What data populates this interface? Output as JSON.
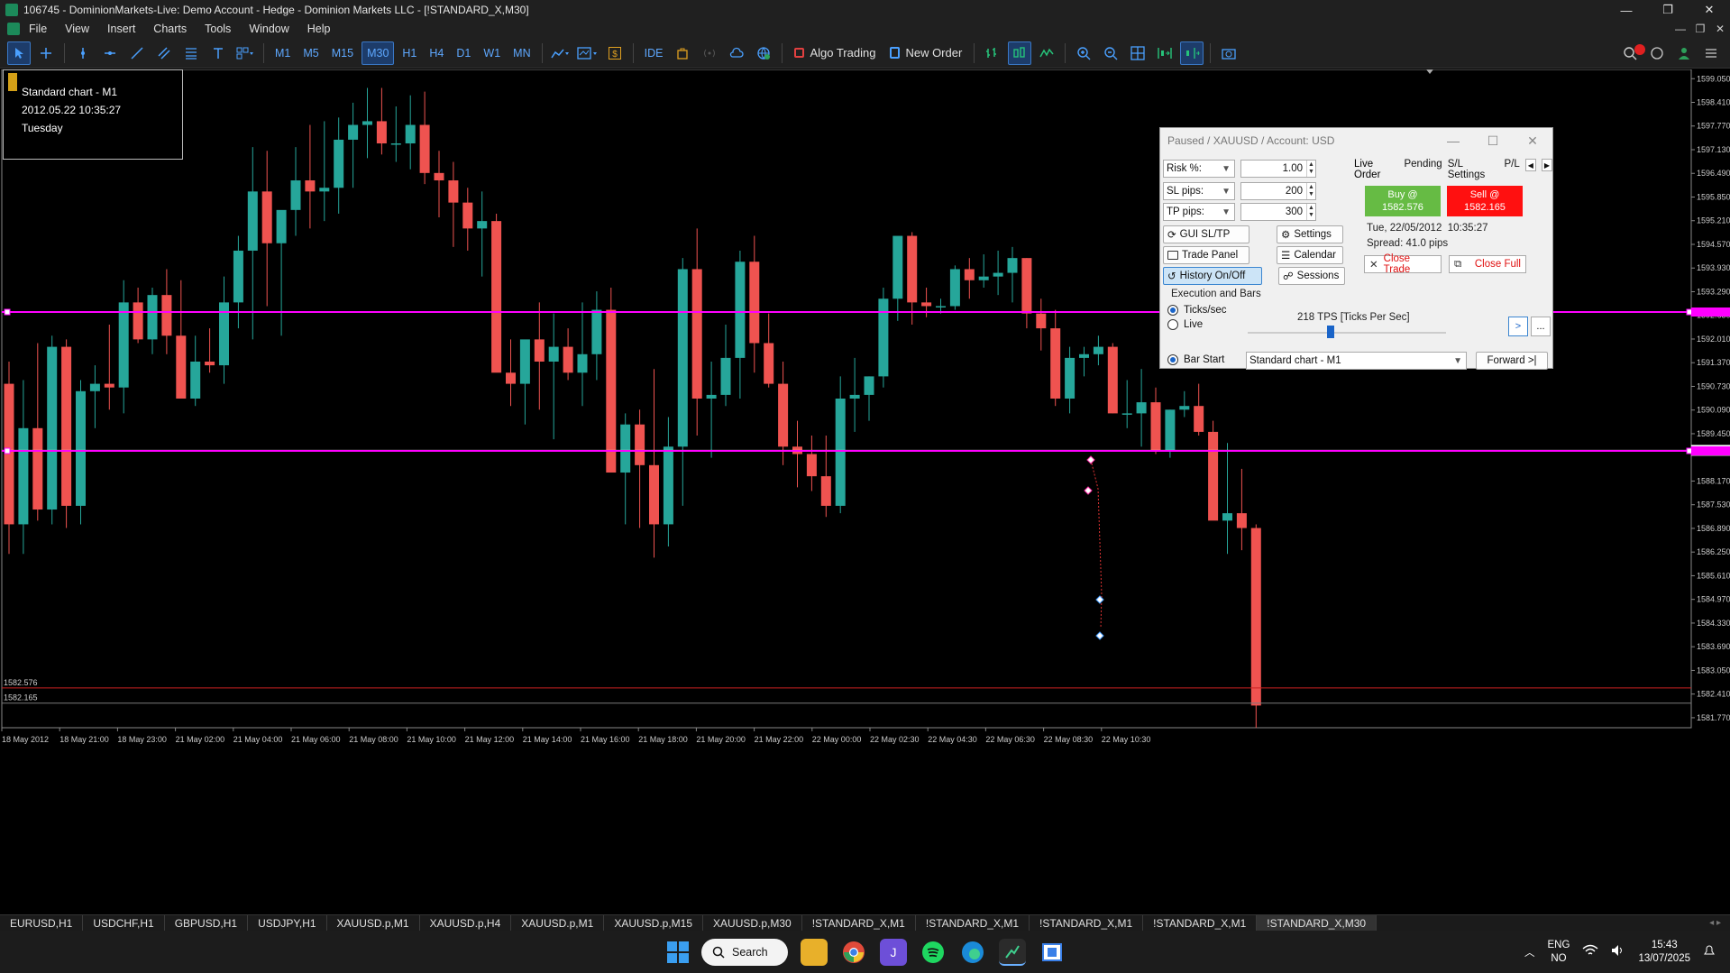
{
  "window": {
    "title": "106745 - DominionMarkets-Live: Demo Account - Hedge - Dominion Markets LLC - [!STANDARD_X,M30]",
    "controls": [
      "—",
      "❐",
      "✕"
    ]
  },
  "menu": {
    "items": [
      "File",
      "View",
      "Insert",
      "Charts",
      "Tools",
      "Window",
      "Help"
    ],
    "right_controls": [
      "—",
      "❐",
      "✕"
    ]
  },
  "toolbar": {
    "timeframes": [
      "M1",
      "M5",
      "M15",
      "M30",
      "H1",
      "H4",
      "D1",
      "W1",
      "MN"
    ],
    "active_timeframe": "M30",
    "ide_label": "IDE",
    "algo_trading_label": "Algo Trading",
    "new_order_label": "New Order"
  },
  "chart_info": {
    "line1": "Standard chart - M1",
    "line2": "2012.05.22 10:35:27",
    "line3": "Tuesday"
  },
  "chart_data": {
    "type": "candlestick",
    "symbol": "XAUUSD",
    "y_ticks": [
      "1599.050",
      "1598.410",
      "1597.770",
      "1597.130",
      "1596.490",
      "1595.850",
      "1595.210",
      "1594.570",
      "1593.930",
      "1593.290",
      "1592.650",
      "1592.010",
      "1591.370",
      "1590.730",
      "1590.090",
      "1589.450",
      "1589.000",
      "1588.170",
      "1587.530",
      "1586.890",
      "1586.250",
      "1585.610",
      "1584.970",
      "1584.330",
      "1583.690",
      "1583.050",
      "1582.410",
      "1581.770"
    ],
    "x_ticks": [
      "18 May 2012",
      "18 May 21:00",
      "18 May 23:00",
      "21 May 02:00",
      "21 May 04:00",
      "21 May 06:00",
      "21 May 08:00",
      "21 May 10:00",
      "21 May 12:00",
      "21 May 14:00",
      "21 May 16:00",
      "21 May 18:00",
      "21 May 20:00",
      "21 May 22:00",
      "22 May 00:00",
      "22 May 02:30",
      "22 May 04:30",
      "22 May 06:30",
      "22 May 08:30",
      "22 May 10:30"
    ],
    "ylim": [
      1581.5,
      1599.3
    ],
    "candles": [
      [
        1590.8,
        1591.4,
        1586.2,
        1587.0
      ],
      [
        1587.0,
        1590.9,
        1586.2,
        1589.6
      ],
      [
        1589.6,
        1591.9,
        1587.1,
        1587.4
      ],
      [
        1587.4,
        1592.1,
        1587.0,
        1591.8
      ],
      [
        1591.8,
        1592.0,
        1586.9,
        1587.5
      ],
      [
        1587.5,
        1590.9,
        1587.0,
        1590.6
      ],
      [
        1590.6,
        1591.3,
        1589.6,
        1590.8
      ],
      [
        1590.8,
        1592.4,
        1590.1,
        1590.7
      ],
      [
        1590.7,
        1593.6,
        1590.0,
        1593.0
      ],
      [
        1593.0,
        1593.4,
        1591.9,
        1592.0
      ],
      [
        1592.0,
        1593.4,
        1591.6,
        1593.2
      ],
      [
        1593.2,
        1593.9,
        1591.6,
        1592.1
      ],
      [
        1592.1,
        1593.6,
        1591.2,
        1590.4
      ],
      [
        1590.4,
        1592.1,
        1590.2,
        1591.4
      ],
      [
        1591.4,
        1592.3,
        1591.1,
        1591.3
      ],
      [
        1591.3,
        1593.7,
        1590.8,
        1593.0
      ],
      [
        1593.0,
        1594.8,
        1592.3,
        1594.4
      ],
      [
        1594.4,
        1597.2,
        1592.0,
        1596.0
      ],
      [
        1596.0,
        1597.1,
        1592.9,
        1594.6
      ],
      [
        1594.6,
        1595.1,
        1592.1,
        1595.5
      ],
      [
        1595.5,
        1597.2,
        1594.8,
        1596.3
      ],
      [
        1596.3,
        1597.8,
        1595.0,
        1596.0
      ],
      [
        1596.0,
        1597.9,
        1595.2,
        1596.1
      ],
      [
        1596.1,
        1598.0,
        1595.4,
        1597.4
      ],
      [
        1597.4,
        1598.4,
        1596.1,
        1597.8
      ],
      [
        1597.8,
        1598.8,
        1596.9,
        1597.9
      ],
      [
        1597.9,
        1598.8,
        1597.0,
        1597.3
      ],
      [
        1597.3,
        1598.3,
        1596.8,
        1597.3
      ],
      [
        1597.3,
        1598.6,
        1596.6,
        1597.8
      ],
      [
        1597.8,
        1598.7,
        1596.2,
        1596.5
      ],
      [
        1596.5,
        1597.1,
        1595.3,
        1596.3
      ],
      [
        1596.3,
        1596.8,
        1594.5,
        1595.7
      ],
      [
        1595.7,
        1596.1,
        1594.4,
        1595.0
      ],
      [
        1595.0,
        1596.0,
        1593.7,
        1595.2
      ],
      [
        1595.2,
        1595.4,
        1592.0,
        1591.1
      ],
      [
        1591.1,
        1592.0,
        1590.2,
        1590.8
      ],
      [
        1590.8,
        1591.9,
        1589.7,
        1592.0
      ],
      [
        1592.0,
        1593.0,
        1590.1,
        1591.4
      ],
      [
        1591.4,
        1592.7,
        1589.3,
        1591.8
      ],
      [
        1591.8,
        1592.3,
        1590.9,
        1591.1
      ],
      [
        1591.1,
        1593.0,
        1590.2,
        1591.6
      ],
      [
        1591.6,
        1593.3,
        1590.9,
        1592.8
      ],
      [
        1592.8,
        1593.4,
        1588.5,
        1588.4
      ],
      [
        1588.4,
        1590.0,
        1587.0,
        1589.7
      ],
      [
        1589.7,
        1590.1,
        1586.9,
        1588.6
      ],
      [
        1588.6,
        1591.2,
        1586.1,
        1587.0
      ],
      [
        1587.0,
        1589.9,
        1586.4,
        1589.1
      ],
      [
        1589.1,
        1594.2,
        1587.5,
        1593.9
      ],
      [
        1593.9,
        1595.0,
        1589.4,
        1590.4
      ],
      [
        1590.4,
        1591.4,
        1588.8,
        1590.5
      ],
      [
        1590.5,
        1592.4,
        1590.2,
        1591.5
      ],
      [
        1591.5,
        1594.4,
        1590.4,
        1594.1
      ],
      [
        1594.1,
        1594.8,
        1591.1,
        1591.9
      ],
      [
        1591.9,
        1592.7,
        1590.7,
        1590.8
      ],
      [
        1590.8,
        1591.4,
        1588.6,
        1589.1
      ],
      [
        1589.1,
        1589.8,
        1588.0,
        1588.9
      ],
      [
        1588.9,
        1589.4,
        1587.9,
        1588.3
      ],
      [
        1588.3,
        1589.4,
        1587.2,
        1587.5
      ],
      [
        1587.5,
        1591.0,
        1587.3,
        1590.4
      ],
      [
        1590.4,
        1591.5,
        1589.5,
        1590.5
      ],
      [
        1590.5,
        1591.0,
        1589.8,
        1591.0
      ],
      [
        1591.0,
        1593.4,
        1590.7,
        1593.1
      ],
      [
        1593.1,
        1594.7,
        1592.5,
        1594.8
      ],
      [
        1594.8,
        1594.9,
        1592.4,
        1593.0
      ],
      [
        1593.0,
        1593.4,
        1592.6,
        1592.9
      ],
      [
        1592.9,
        1593.1,
        1592.7,
        1592.9
      ],
      [
        1592.9,
        1594.0,
        1592.8,
        1593.9
      ],
      [
        1593.9,
        1594.2,
        1593.1,
        1593.6
      ],
      [
        1593.6,
        1594.3,
        1593.4,
        1593.7
      ],
      [
        1593.7,
        1594.4,
        1593.2,
        1593.8
      ],
      [
        1593.8,
        1594.5,
        1593.0,
        1594.2
      ],
      [
        1594.2,
        1594.2,
        1592.3,
        1592.7
      ],
      [
        1592.7,
        1593.1,
        1591.7,
        1592.3
      ],
      [
        1592.3,
        1592.8,
        1590.2,
        1590.4
      ],
      [
        1590.4,
        1591.8,
        1590.0,
        1591.5
      ],
      [
        1591.5,
        1591.8,
        1591.0,
        1591.6
      ],
      [
        1591.6,
        1592.1,
        1591.3,
        1591.8
      ],
      [
        1591.8,
        1591.9,
        1590.0,
        1590.0
      ],
      [
        1590.0,
        1590.9,
        1589.6,
        1590.0
      ],
      [
        1590.0,
        1591.2,
        1589.1,
        1590.3
      ],
      [
        1590.3,
        1590.7,
        1588.9,
        1589.0
      ],
      [
        1589.0,
        1590.1,
        1588.8,
        1590.1
      ],
      [
        1590.1,
        1590.6,
        1589.9,
        1590.2
      ],
      [
        1590.2,
        1590.8,
        1589.4,
        1589.5
      ],
      [
        1589.5,
        1589.8,
        1587.5,
        1587.1
      ],
      [
        1587.1,
        1589.2,
        1586.2,
        1587.3
      ],
      [
        1587.3,
        1588.5,
        1586.3,
        1586.9
      ],
      [
        1586.9,
        1587.0,
        1581.5,
        1582.1
      ]
    ]
  },
  "chart_levels": {
    "buy_price": "1582.576",
    "sell_price": "1582.165",
    "current_price": "1589.000"
  },
  "panel": {
    "title": "Paused / XAUUSD / Account: USD",
    "risk_label": "Risk %:",
    "risk_value": "1.00",
    "sl_label": "SL pips:",
    "sl_value": "200",
    "tp_label": "TP pips:",
    "tp_value": "300",
    "btn_gui": "GUI SL/TP",
    "btn_settings": "Settings",
    "btn_trade_panel": "Trade Panel",
    "btn_calendar": "Calendar",
    "btn_history": "History On/Off",
    "btn_sessions": "Sessions",
    "tabs": [
      "Live Order",
      "Pending",
      "S/L Settings",
      "P/L"
    ],
    "buy_line1": "Buy @",
    "buy_line2": "1582.576",
    "sell_line1": "Sell @",
    "sell_line2": "1582.165",
    "datetime": "Tue, 22/05/2012  10:35:27",
    "spread": "Spread: 41.0 pips",
    "close_trade": "Close Trade",
    "close_full": "Close Full",
    "exec_group": "Execution and Bars",
    "radio_ticks": "Ticks/sec",
    "radio_live": "Live",
    "tps_label": "218 TPS [Ticks Per Sec]",
    "tps_level_fraction": 0.42,
    "play_btn": ">",
    "more_btn": "...",
    "bar_start": "Bar Start",
    "bar_select": "Standard chart - M1",
    "forward_btn": "Forward >|"
  },
  "symbol_tabs": [
    "EURUSD,H1",
    "USDCHF,H1",
    "GBPUSD,H1",
    "USDJPY,H1",
    "XAUUSD.p,M1",
    "XAUUSD.p,H4",
    "XAUUSD.p,M1",
    "XAUUSD.p,M15",
    "XAUUSD.p,M30",
    "!STANDARD_X,M1",
    "!STANDARD_X,M1",
    "!STANDARD_X,M1",
    "!STANDARD_X,M1",
    "!STANDARD_X,M30"
  ],
  "active_symbol_tab": 13,
  "taskbar": {
    "search_label": "Search",
    "lang": "ENG",
    "region": "NO",
    "time": "15:43",
    "date": "13/07/2025"
  },
  "colors": {
    "bull": "#26a69a",
    "bear": "#ef5350",
    "magenta": "#ff00ff",
    "buy_line": "#cc2222",
    "sell_line": "#7a7a7a"
  }
}
